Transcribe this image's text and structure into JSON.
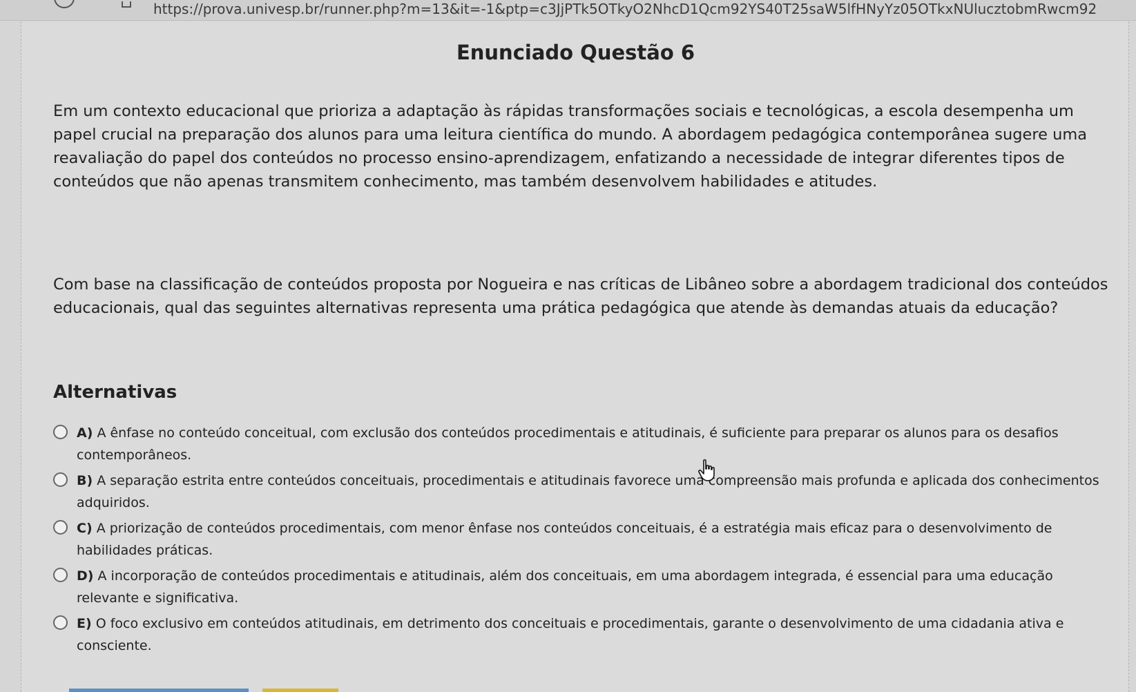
{
  "browser": {
    "url": "https://prova.univesp.br/runner.php?m=13&it=-1&ptp=c3JjPTk5OTkyO2NhcD1Qcm92YS40T25saW5lfHNyYz05OTkxNUlucztobmRwcm92"
  },
  "question": {
    "title": "Enunciado Questão 6",
    "paragraph1": "Em um contexto educacional que prioriza a adaptação às rápidas transformações sociais e tecnológicas, a escola desempenha um papel crucial na preparação dos alunos para uma leitura científica do mundo. A abordagem pedagógica contemporânea sugere uma reavaliação do papel dos conteúdos no processo ensino-aprendizagem, enfatizando a necessidade de integrar diferentes tipos de conteúdos que não apenas transmitem conhecimento, mas também desenvolvem habilidades e atitudes.",
    "paragraph2": "Com base na classificação de conteúdos proposta por Nogueira e nas críticas de Libâneo sobre a abordagem tradicional dos conteúdos educacionais, qual das seguintes alternativas representa uma prática pedagógica que atende às demandas atuais da educação?"
  },
  "alternatives": {
    "heading": "Alternativas",
    "options": [
      {
        "letter": "A)",
        "text": "A ênfase no conteúdo conceitual, com exclusão dos conteúdos procedimentais e atitudinais, é suficiente para preparar os alunos para os desafios contemporâneos."
      },
      {
        "letter": "B)",
        "text": "A separação estrita entre conteúdos conceituais, procedimentais e atitudinais favorece uma compreensão mais profunda e aplicada dos conhecimentos adquiridos."
      },
      {
        "letter": "C)",
        "text": "A priorização de conteúdos procedimentais, com menor ênfase nos conteúdos conceituais, é a estratégia mais eficaz para o desenvolvimento de habilidades práticas."
      },
      {
        "letter": "D)",
        "text": "A incorporação de conteúdos procedimentais e atitudinais, além dos conceituais, em uma abordagem integrada, é essencial para uma educação relevante e significativa."
      },
      {
        "letter": "E)",
        "text": "O foco exclusivo em conteúdos atitudinais, em detrimento dos conceituais e procedimentais, garante o desenvolvimento de uma cidadania ativa e consciente."
      }
    ]
  },
  "icons": {
    "cursor": "hand-pointer-icon",
    "radio": "radio-unchecked-icon"
  },
  "colors": {
    "page_background": "#dbdbdb",
    "text": "#222222",
    "bar_blue": "#5b8fc5",
    "bar_yellow": "#d9b53a"
  }
}
